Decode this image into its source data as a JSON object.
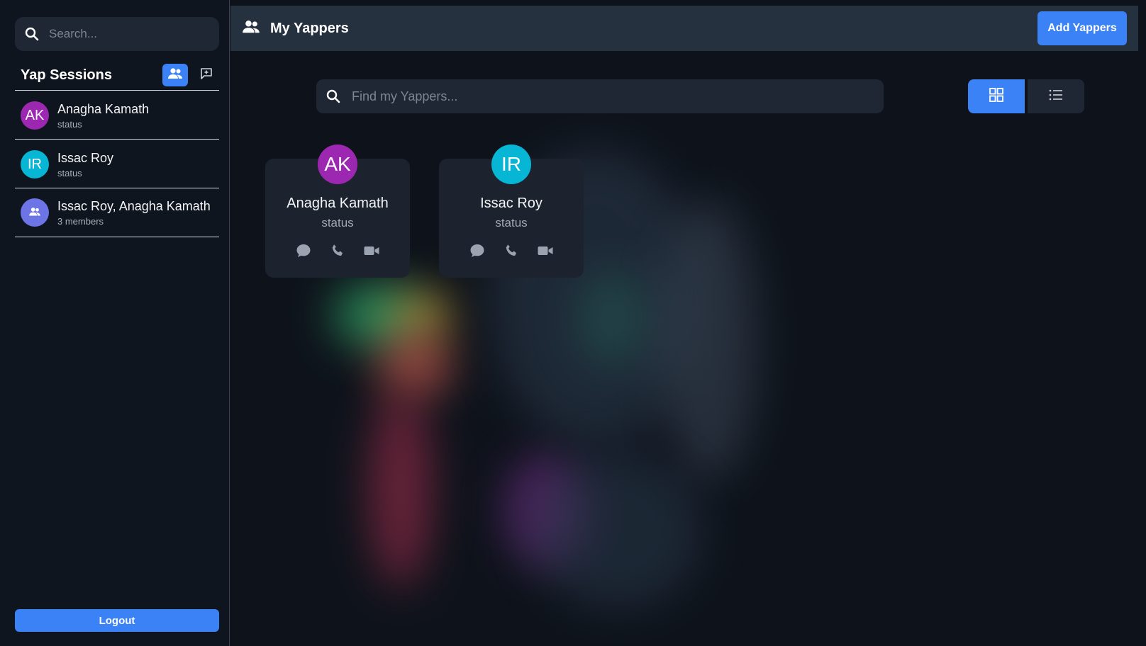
{
  "sidebar": {
    "search_placeholder": "Search...",
    "title": "Yap Sessions",
    "sessions": [
      {
        "initials": "AK",
        "name": "Anagha Kamath",
        "sub": "status",
        "color": "#9c27b0"
      },
      {
        "initials": "IR",
        "name": "Issac Roy",
        "sub": "status",
        "color": "#06b6d4"
      },
      {
        "initials": "",
        "name": "Issac Roy, Anagha Kamath",
        "sub": "3 members",
        "color": "#6d74e6",
        "icon": "group-icon"
      }
    ],
    "logout_label": "Logout"
  },
  "topbar": {
    "title": "My Yappers",
    "add_label": "Add Yappers"
  },
  "main": {
    "find_placeholder": "Find my Yappers...",
    "view_modes": [
      "grid",
      "list"
    ],
    "active_view": "grid",
    "cards": [
      {
        "initials": "AK",
        "name": "Anagha Kamath",
        "status": "status",
        "color": "#9c27b0"
      },
      {
        "initials": "IR",
        "name": "Issac Roy",
        "status": "status",
        "color": "#06b6d4"
      }
    ]
  },
  "colors": {
    "accent": "#3b82f6",
    "background": "#0e131b",
    "panel": "#1f2735"
  }
}
